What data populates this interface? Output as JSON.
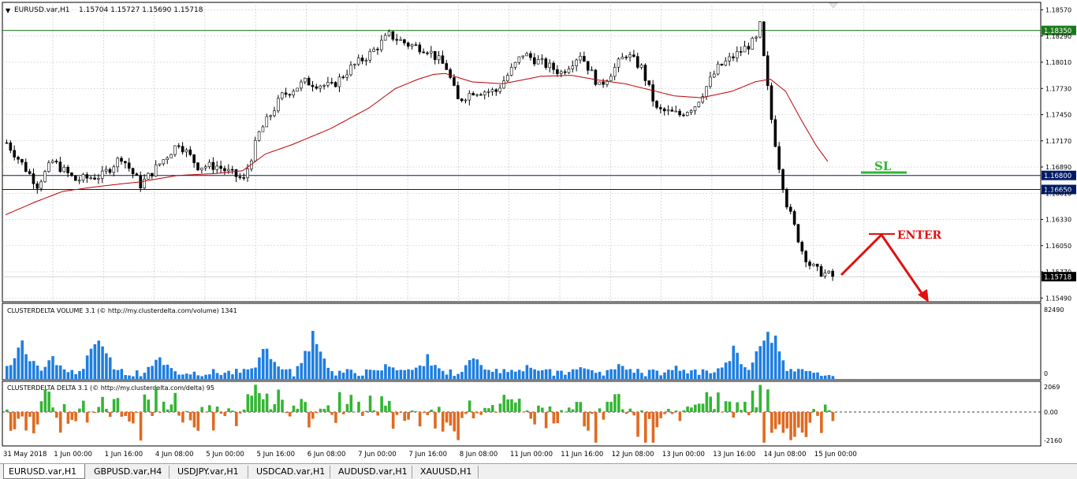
{
  "header": {
    "symbol_label": "EURUSD.var,H1",
    "ohlc_label": "1.15704 1.15727 1.15690 1.15718"
  },
  "tabs": [
    {
      "label": "EURUSD.var,H1",
      "active": true
    },
    {
      "label": "GBPUSD.var,H4",
      "active": false
    },
    {
      "label": "USDJPY.var,H1",
      "active": false
    },
    {
      "label": "USDCAD.var,H1",
      "active": false
    },
    {
      "label": "AUDUSD.var,H1",
      "active": false
    },
    {
      "label": "XAUUSD,H1",
      "active": false
    }
  ],
  "colors": {
    "background": "#ffffff",
    "grid": "#c0c0c0",
    "candle": "#000000",
    "moving_average": "#c00000",
    "level_green": "#1a7a1a",
    "level_navy": "#001a66",
    "sl_green": "#2db82d",
    "enter_red": "#e01010",
    "volume_bar": "#1e7ee0",
    "delta_positive": "#34b534",
    "delta_negative": "#e06a20"
  },
  "chart_data": [
    {
      "type": "candlestick",
      "title": "EURUSD.var,H1",
      "x_tick_labels": [
        "31 May 2018",
        "1 Jun 00:00",
        "1 Jun 16:00",
        "4 Jun 08:00",
        "5 Jun 00:00",
        "5 Jun 16:00",
        "6 Jun 08:00",
        "7 Jun 00:00",
        "7 Jun 16:00",
        "8 Jun 08:00",
        "11 Jun 00:00",
        "11 Jun 16:00",
        "12 Jun 08:00",
        "13 Jun 00:00",
        "13 Jun 16:00",
        "14 Jun 08:00",
        "15 Jun 00:00"
      ],
      "y_tick_labels": [
        "1.18570",
        "1.18290",
        "1.18010",
        "1.17730",
        "1.17450",
        "1.17170",
        "1.16890",
        "1.16610",
        "1.16330",
        "1.16050",
        "1.15770",
        "1.15490"
      ],
      "ylim": [
        1.1545,
        1.1865
      ],
      "close_path": [
        [
          0,
          1.1715
        ],
        [
          8,
          1.167
        ],
        [
          12,
          1.1695
        ],
        [
          18,
          1.1675
        ],
        [
          25,
          1.168
        ],
        [
          30,
          1.17
        ],
        [
          35,
          1.167
        ],
        [
          45,
          1.1715
        ],
        [
          50,
          1.169
        ],
        [
          55,
          1.169
        ],
        [
          62,
          1.1675
        ],
        [
          66,
          1.1725
        ],
        [
          72,
          1.1765
        ],
        [
          78,
          1.178
        ],
        [
          85,
          1.1775
        ],
        [
          90,
          1.1795
        ],
        [
          95,
          1.181
        ],
        [
          100,
          1.183
        ],
        [
          105,
          1.182
        ],
        [
          110,
          1.1815
        ],
        [
          115,
          1.1795
        ],
        [
          118,
          1.176
        ],
        [
          122,
          1.177
        ],
        [
          128,
          1.177
        ],
        [
          135,
          1.181
        ],
        [
          140,
          1.18
        ],
        [
          145,
          1.179
        ],
        [
          150,
          1.181
        ],
        [
          155,
          1.1775
        ],
        [
          158,
          1.179
        ],
        [
          162,
          1.181
        ],
        [
          166,
          1.1795
        ],
        [
          170,
          1.175
        ],
        [
          176,
          1.1745
        ],
        [
          180,
          1.1755
        ],
        [
          186,
          1.1795
        ],
        [
          191,
          1.181
        ],
        [
          196,
          1.1825
        ],
        [
          197,
          1.184
        ],
        [
          198,
          1.1805
        ],
        [
          200,
          1.174
        ],
        [
          202,
          1.169
        ],
        [
          204,
          1.165
        ],
        [
          206,
          1.1625
        ],
        [
          208,
          1.16
        ],
        [
          210,
          1.1585
        ],
        [
          212,
          1.1578
        ],
        [
          214,
          1.1575
        ],
        [
          216,
          1.1572
        ]
      ],
      "moving_average": [
        [
          0,
          1.1638
        ],
        [
          8,
          1.1652
        ],
        [
          15,
          1.1663
        ],
        [
          22,
          1.1667
        ],
        [
          28,
          1.167
        ],
        [
          35,
          1.1673
        ],
        [
          45,
          1.168
        ],
        [
          55,
          1.1682
        ],
        [
          62,
          1.1685
        ],
        [
          68,
          1.1703
        ],
        [
          75,
          1.1713
        ],
        [
          85,
          1.173
        ],
        [
          95,
          1.1752
        ],
        [
          102,
          1.1773
        ],
        [
          108,
          1.1783
        ],
        [
          112,
          1.1788
        ],
        [
          115,
          1.1789
        ],
        [
          122,
          1.178
        ],
        [
          130,
          1.1778
        ],
        [
          135,
          1.1782
        ],
        [
          140,
          1.1786
        ],
        [
          148,
          1.1787
        ],
        [
          155,
          1.1782
        ],
        [
          162,
          1.1778
        ],
        [
          168,
          1.1772
        ],
        [
          175,
          1.1765
        ],
        [
          182,
          1.1763
        ],
        [
          190,
          1.177
        ],
        [
          196,
          1.178
        ],
        [
          200,
          1.1783
        ],
        [
          204,
          1.177
        ],
        [
          208,
          1.174
        ],
        [
          212,
          1.1712
        ],
        [
          215,
          1.1695
        ]
      ],
      "levels": [
        {
          "value": 1.1835,
          "label": "1.18350",
          "color": "#1a7a1a"
        },
        {
          "value": 1.168,
          "label": "1.16800",
          "color": "#001a66"
        },
        {
          "value": 1.1665,
          "label": "1.16650",
          "color": "#001a66"
        },
        {
          "value": 1.15718,
          "label": "1.15718",
          "color": "#000000"
        }
      ],
      "annotations": [
        {
          "text": "SL",
          "color": "#2db82d"
        },
        {
          "text": "ENTER",
          "color": "#e01010"
        }
      ]
    },
    {
      "type": "bar",
      "title": "CLUSTERDELTA VOLUME 3.1 (© http://my.clusterdelta.com/volume) 1341",
      "y_tick_labels": [
        "82490",
        "0"
      ],
      "ylim": [
        0,
        82490
      ],
      "description_source": "volume per hourly bar",
      "bursts": [
        {
          "at": 4,
          "peak": 52000
        },
        {
          "at": 12,
          "peak": 30000
        },
        {
          "at": 24,
          "peak": 58000
        },
        {
          "at": 40,
          "peak": 32000
        },
        {
          "at": 68,
          "peak": 44000
        },
        {
          "at": 80,
          "peak": 58000
        },
        {
          "at": 100,
          "peak": 22000
        },
        {
          "at": 110,
          "peak": 30000
        },
        {
          "at": 122,
          "peak": 28000
        },
        {
          "at": 136,
          "peak": 18000
        },
        {
          "at": 150,
          "peak": 18000
        },
        {
          "at": 160,
          "peak": 20000
        },
        {
          "at": 175,
          "peak": 18000
        },
        {
          "at": 190,
          "peak": 42000
        },
        {
          "at": 199,
          "peak": 82000
        },
        {
          "at": 206,
          "peak": 12000
        }
      ]
    },
    {
      "type": "bar",
      "title": "CLUSTERDELTA DELTA 3.1 (© http://my.clusterdelta.com/delta) 95",
      "y_tick_labels": [
        "2069",
        "0.00",
        "-2160"
      ],
      "ylim": [
        -2160,
        2069
      ],
      "bars_positive_color": "#34b534",
      "bars_negative_color": "#e06a20"
    }
  ]
}
